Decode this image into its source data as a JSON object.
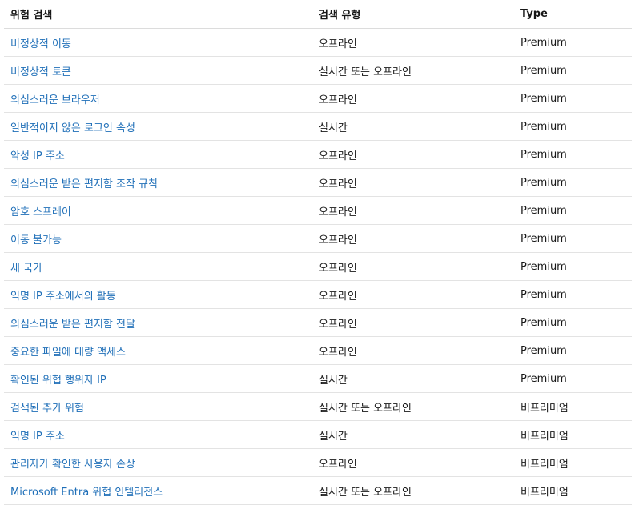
{
  "table": {
    "headers": [
      "위험 검색",
      "검색 유형",
      "Type"
    ],
    "rows": [
      [
        "비정상적 이동",
        "오프라인",
        "Premium"
      ],
      [
        "비정상적 토큰",
        "실시간 또는 오프라인",
        "Premium"
      ],
      [
        "의심스러운 브라우저",
        "오프라인",
        "Premium"
      ],
      [
        "일반적이지 않은 로그인 속성",
        "실시간",
        "Premium"
      ],
      [
        "악성 IP 주소",
        "오프라인",
        "Premium"
      ],
      [
        "의심스러운 받은 편지함 조작 규칙",
        "오프라인",
        "Premium"
      ],
      [
        "암호 스프레이",
        "오프라인",
        "Premium"
      ],
      [
        "이동 불가능",
        "오프라인",
        "Premium"
      ],
      [
        "새 국가",
        "오프라인",
        "Premium"
      ],
      [
        "익명 IP 주소에서의 활동",
        "오프라인",
        "Premium"
      ],
      [
        "의심스러운 받은 편지함 전달",
        "오프라인",
        "Premium"
      ],
      [
        "중요한 파일에 대량 액세스",
        "오프라인",
        "Premium"
      ],
      [
        "확인된 위협 행위자 IP",
        "실시간",
        "Premium"
      ],
      [
        "검색된 추가 위험",
        "실시간 또는 오프라인",
        "비프리미엄"
      ],
      [
        "익명 IP 주소",
        "실시간",
        "비프리미엄"
      ],
      [
        "관리자가 확인한 사용자 손상",
        "오프라인",
        "비프리미엄"
      ],
      [
        "Microsoft Entra 위협 인텔리전스",
        "실시간 또는 오프라인",
        "비프리미엄"
      ]
    ]
  }
}
